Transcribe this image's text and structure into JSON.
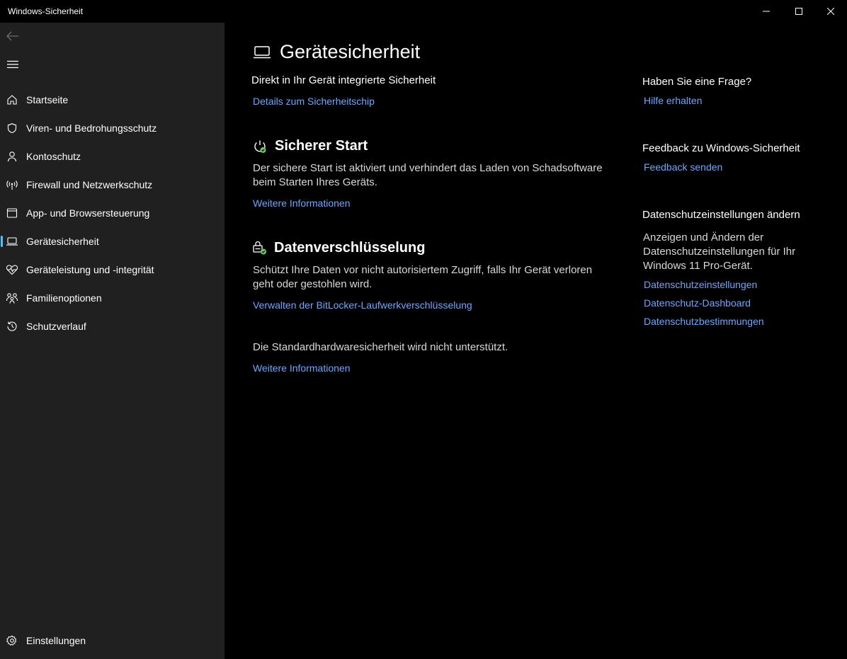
{
  "window": {
    "title": "Windows-Sicherheit"
  },
  "sidebar": {
    "items": [
      {
        "label": "Startseite",
        "icon": "home-icon"
      },
      {
        "label": "Viren- und Bedrohungsschutz",
        "icon": "shield-icon"
      },
      {
        "label": "Kontoschutz",
        "icon": "person-icon"
      },
      {
        "label": "Firewall und Netzwerkschutz",
        "icon": "antenna-icon"
      },
      {
        "label": "App- und Browsersteuerung",
        "icon": "browser-icon"
      },
      {
        "label": "Gerätesicherheit",
        "icon": "laptop-icon",
        "active": true
      },
      {
        "label": "Geräteleistung und -integrität",
        "icon": "heart-pulse-icon"
      },
      {
        "label": "Familienoptionen",
        "icon": "family-icon"
      },
      {
        "label": "Schutzverlauf",
        "icon": "history-icon"
      }
    ],
    "settings_label": "Einstellungen"
  },
  "main": {
    "title": "Gerätesicherheit",
    "subtitle": "Direkt in Ihr Gerät integrierte Sicherheit",
    "chip_link": "Details zum Sicherheitschip",
    "secure_boot": {
      "title": "Sicherer Start",
      "desc": "Der sichere Start ist aktiviert und verhindert das Laden von Schadsoftware beim Starten Ihres Geräts.",
      "link": "Weitere Informationen"
    },
    "encryption": {
      "title": "Datenverschlüsselung",
      "desc": "Schützt Ihre Daten vor nicht autorisiertem Zugriff, falls Ihr Gerät verloren geht oder gestohlen wird.",
      "link": "Verwalten der BitLocker-Laufwerkverschlüsselung"
    },
    "hardware": {
      "text": "Die Standardhardwaresicherheit wird nicht unterstützt.",
      "link": "Weitere Informationen"
    }
  },
  "right": {
    "question": {
      "heading": "Haben Sie eine Frage?",
      "link": "Hilfe erhalten"
    },
    "feedback": {
      "heading": "Feedback zu Windows-Sicherheit",
      "link": "Feedback senden"
    },
    "privacy": {
      "heading": "Datenschutzeinstellungen ändern",
      "desc": "Anzeigen und Ändern der Datenschutzeinstellungen für Ihr Windows 11 Pro-Gerät.",
      "links": [
        "Datenschutzeinstellungen",
        "Datenschutz-Dashboard",
        "Datenschutzbestimmungen"
      ]
    }
  },
  "colors": {
    "accent": "#4cc2ff",
    "link": "#6fa6ff",
    "sidebar_bg": "#202020",
    "main_bg": "#000000",
    "status_ok": "#6ccb5f"
  }
}
